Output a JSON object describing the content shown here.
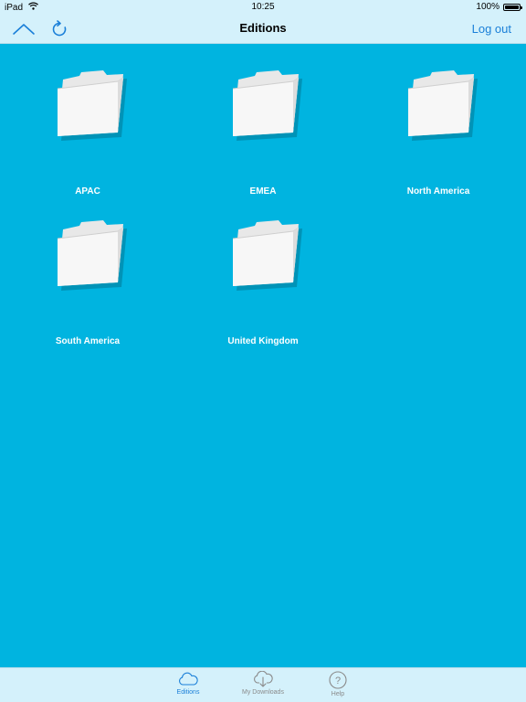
{
  "status_bar": {
    "device": "iPad",
    "time": "10:25",
    "battery": "100%",
    "battery_level": 1.0
  },
  "nav_bar": {
    "title": "Editions",
    "logout_label": "Log out",
    "up_icon": "chevron-up-icon",
    "refresh_icon": "refresh-icon",
    "accent_color": "#1a7fd8"
  },
  "folders": [
    {
      "label": "APAC"
    },
    {
      "label": "EMEA"
    },
    {
      "label": "North America"
    },
    {
      "label": "South America"
    },
    {
      "label": "United Kingdom"
    }
  ],
  "tab_bar": {
    "tabs": [
      {
        "label": "Editions",
        "icon": "cloud-icon",
        "active": true
      },
      {
        "label": "My Downloads",
        "icon": "cloud-download-icon",
        "active": false
      },
      {
        "label": "Help",
        "icon": "help-icon",
        "active": false
      }
    ]
  },
  "colors": {
    "background": "#00b4e0",
    "bars": "#d4f1fb"
  }
}
